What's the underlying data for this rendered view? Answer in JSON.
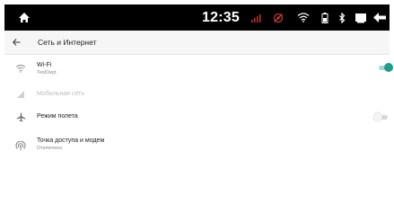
{
  "status_bar": {
    "time": "12:35",
    "icons": [
      "home-icon",
      "signal-icon",
      "camera-off-icon",
      "wifi-icon",
      "battery-icon",
      "bluetooth-icon",
      "window-icon",
      "back-icon"
    ]
  },
  "header": {
    "title": "Сеть и Интернет"
  },
  "items": [
    {
      "label": "Wi-Fi",
      "subtitle": "TestDept",
      "toggle": "on"
    },
    {
      "label": "Мобильная сеть"
    },
    {
      "label": "Режим полета",
      "toggle": "off"
    },
    {
      "label": "Точка доступа и модем",
      "subtitle": "Отключено"
    }
  ],
  "colors": {
    "status_bar_bg": "#000000",
    "accent": "#1e9e8a",
    "accent_track": "#9fd8cf",
    "signal_icon": "#c0392b"
  }
}
